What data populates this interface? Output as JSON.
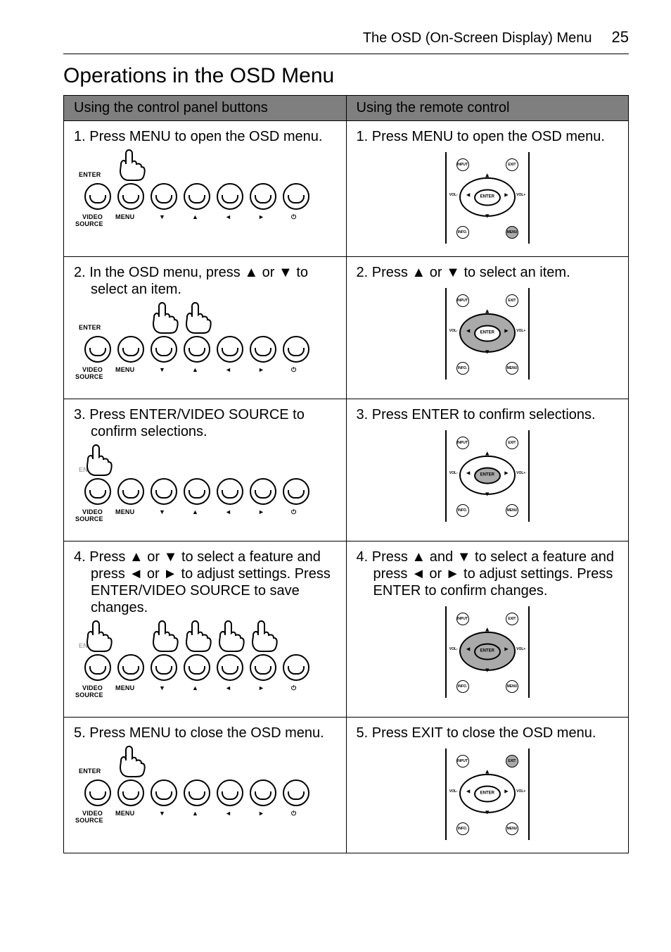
{
  "header": {
    "section": "The OSD (On-Screen Display) Menu",
    "page_number": "25"
  },
  "section_title": "Operations in the OSD Menu",
  "table": {
    "headers": {
      "left": "Using the control panel buttons",
      "right": "Using the remote control"
    },
    "panel_labels_top": "ENTER",
    "panel_labels_bottom": [
      "VIDEO",
      "MENU",
      "▼",
      "▲",
      "◄",
      "►",
      "⏻"
    ],
    "panel_source": "SOURCE",
    "remote_labels": {
      "center": "ENTER",
      "input": "INPUT",
      "exit": "EXIT",
      "info": "INFO.",
      "menu": "MENU",
      "vol_minus": "VOL-",
      "vol_plus": "VOL+"
    },
    "rows": [
      {
        "left_text": "1. Press MENU to open the OSD menu.",
        "right_text": "1. Press MENU to open the OSD menu.",
        "panel_highlight": [
          1
        ],
        "panel_enter_dim": false,
        "remote_highlight": {
          "ring": false,
          "center": false,
          "tiny": "br"
        }
      },
      {
        "left_text": "2. In the OSD menu, press ▲ or ▼ to select an item.",
        "right_text": "2. Press ▲ or ▼ to select an item.",
        "panel_highlight": [
          2,
          3
        ],
        "panel_enter_dim": false,
        "remote_highlight": {
          "ring": true,
          "center": false,
          "tiny": null
        }
      },
      {
        "left_text": "3. Press ENTER/VIDEO SOURCE to confirm selections.",
        "right_text": "3. Press ENTER to confirm selections.",
        "panel_highlight": [
          0
        ],
        "panel_enter_dim": true,
        "remote_highlight": {
          "ring": false,
          "center": true,
          "tiny": null
        }
      },
      {
        "left_text": "4. Press ▲ or ▼ to select a feature and press ◄ or ► to adjust settings. Press ENTER/VIDEO SOURCE to save changes.",
        "right_text": "4. Press ▲ and ▼ to select a feature and press ◄ or ► to adjust settings. Press ENTER to confirm changes.",
        "panel_highlight": [
          0,
          2,
          3,
          4,
          5
        ],
        "panel_enter_dim": true,
        "remote_highlight": {
          "ring": true,
          "center": true,
          "tiny": null
        }
      },
      {
        "left_text": "5. Press MENU to close the OSD menu.",
        "right_text": "5. Press EXIT to close the OSD menu.",
        "panel_highlight": [
          1
        ],
        "panel_enter_dim": false,
        "remote_highlight": {
          "ring": false,
          "center": false,
          "tiny": "tr"
        }
      }
    ]
  }
}
